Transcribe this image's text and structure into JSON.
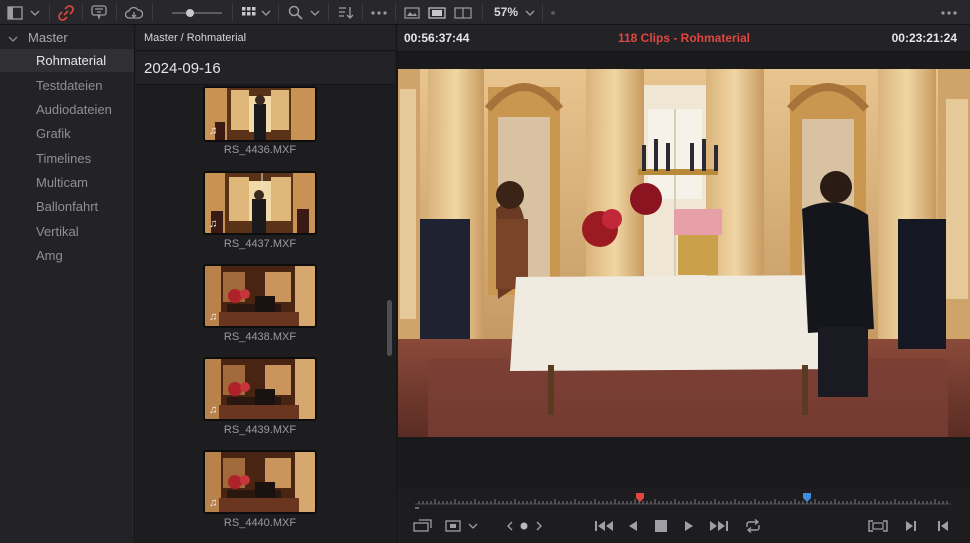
{
  "toolbar": {
    "zoom_label": "57%",
    "icons": [
      "panel-toggle-icon",
      "link-icon",
      "filter-icon",
      "cloud-icon",
      "thumb-size-slider",
      "grid-view-icon",
      "search-icon",
      "sort-icon",
      "more-icon",
      "viewer-mode-icons",
      "more-icon"
    ]
  },
  "sidebar": {
    "root": "Master",
    "items": [
      {
        "label": "Rohmaterial",
        "active": true
      },
      {
        "label": "Testdateien",
        "active": false
      },
      {
        "label": "Audiodateien",
        "active": false
      },
      {
        "label": "Grafik",
        "active": false
      },
      {
        "label": "Timelines",
        "active": false
      },
      {
        "label": "Multicam",
        "active": false
      },
      {
        "label": "Ballonfahrt",
        "active": false
      },
      {
        "label": "Vertikal",
        "active": false
      },
      {
        "label": "Amg",
        "active": false
      }
    ]
  },
  "pool": {
    "breadcrumb": "Master / Rohmaterial",
    "date": "2024-09-16",
    "clips": [
      {
        "name": "RS_4436.MXF"
      },
      {
        "name": "RS_4437.MXF"
      },
      {
        "name": "RS_4438.MXF"
      },
      {
        "name": "RS_4439.MXF"
      },
      {
        "name": "RS_4440.MXF"
      }
    ],
    "audio_glyph": "♫"
  },
  "viewer": {
    "timecode_left": "00:56:37:44",
    "title": "118 Clips - Rohmaterial",
    "timecode_right": "00:23:21:24",
    "accent": "#e0463e"
  },
  "transport": {
    "in_marker_color": "#e0463e",
    "playhead_color": "#3f8fe0"
  }
}
